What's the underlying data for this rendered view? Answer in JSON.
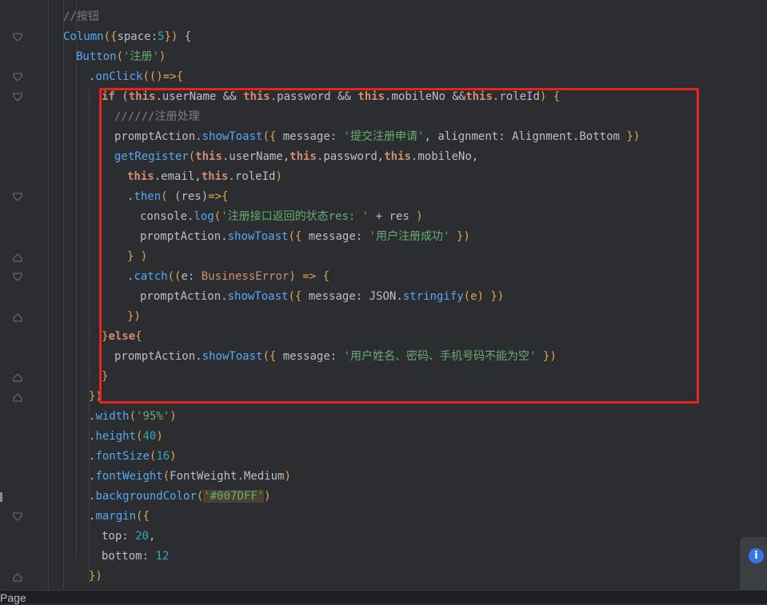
{
  "code": {
    "line01": {
      "comment": "//按钮"
    },
    "line02": {
      "fn": "Column",
      "open": "({",
      "param": "space",
      "colon": ":",
      "num": "5",
      "close": "})",
      "brace": " {"
    },
    "line03": {
      "fn": "Button",
      "open": "(",
      "str": "'注册'",
      "close": ")"
    },
    "line04": {
      "dot": ".",
      "fn": "onClick",
      "rest": "(()=>{"
    },
    "line05": {
      "kw": "if",
      "p1": " (",
      "k1": "this",
      "t1": ".userName && ",
      "k2": "this",
      "t2": ".password && ",
      "k3": "this",
      "t3": ".mobileNo &&",
      "k4": "this",
      "t4": ".roleId",
      "p2": ") {"
    },
    "line06": {
      "comment": "//////注册处理"
    },
    "line07": {
      "obj": "promptAction",
      "dot": ".",
      "fn": "showToast",
      "p1": "({ ",
      "key": "message",
      "colon": ": ",
      "str": "'提交注册申请'",
      "comma": ", ",
      "key2": "alignment",
      "colon2": ": ",
      "cls": "Alignment.Bottom",
      "p2": " })"
    },
    "line08": {
      "fn": "getRegister",
      "p1": "(",
      "k1": "this",
      "t1": ".userName,",
      "k2": "this",
      "t2": ".password,",
      "k3": "this",
      "t3": ".mobileNo,"
    },
    "line09": {
      "k1": "this",
      "t1": ".email,",
      "k2": "this",
      "t2": ".roleId",
      "p2": ")"
    },
    "line10": {
      "dot": ".",
      "fn": "then",
      "p1": "( ",
      "param": "(res)",
      "arrow": "=>{"
    },
    "line11": {
      "obj": "console",
      "dot": ".",
      "fn": "log",
      "p1": "(",
      "str": "'注册接口返回的状态res: '",
      "plus": " + res ",
      "p2": ")"
    },
    "line12": {
      "obj": "promptAction",
      "dot": ".",
      "fn": "showToast",
      "p1": "({ ",
      "key": "message",
      "colon": ": ",
      "str": "'用户注册成功'",
      "p2": " })"
    },
    "line13": {
      "text": "} )"
    },
    "line14": {
      "dot": ".",
      "fn": "catch",
      "p1": "((",
      "param": "e",
      "colon": ": ",
      "type": "BusinessError",
      "p2": ") => {"
    },
    "line15": {
      "obj": "promptAction",
      "dot": ".",
      "fn": "showToast",
      "p1": "({ ",
      "key": "message",
      "colon": ": ",
      "cls": "JSON",
      "dot2": ".",
      "fn2": "stringify",
      "p2": "(e) })"
    },
    "line16": {
      "text": "})"
    },
    "line17": {
      "b1": "}",
      "kw": "else",
      "b2": "{"
    },
    "line18": {
      "obj": "promptAction",
      "dot": ".",
      "fn": "showToast",
      "p1": "({ ",
      "key": "message",
      "colon": ": ",
      "str": "'用户姓名、密码、手机号码不能为空'",
      "p2": " })"
    },
    "line19": {
      "text": "}"
    },
    "line20": {
      "text": "})"
    },
    "line21": {
      "dot": ".",
      "fn": "width",
      "p1": "(",
      "str": "'95%'",
      "p2": ")"
    },
    "line22": {
      "dot": ".",
      "fn": "height",
      "p1": "(",
      "num": "40",
      "p2": ")"
    },
    "line23": {
      "dot": ".",
      "fn": "fontSize",
      "p1": "(",
      "num": "16",
      "p2": ")"
    },
    "line24": {
      "dot": ".",
      "fn": "fontWeight",
      "p1": "(",
      "cls": "FontWeight.Medium",
      "p2": ")"
    },
    "line25": {
      "dot": ".",
      "fn": "backgroundColor",
      "p1": "(",
      "str": "'#007DFF'",
      "p2": ")"
    },
    "line26": {
      "dot": ".",
      "fn": "margin",
      "p1": "({"
    },
    "line27": {
      "key": "top",
      "colon": ": ",
      "num": "20",
      "comma": ","
    },
    "line28": {
      "key": "bottom",
      "colon": ": ",
      "num": "12"
    },
    "line29": {
      "text": "})"
    }
  },
  "statusbar": {
    "tab_label": "Page"
  },
  "notification": {
    "icon": "info-icon",
    "glyph": "i"
  },
  "colors": {
    "highlight_border": "#e5251d",
    "background": "#2b2d30"
  }
}
